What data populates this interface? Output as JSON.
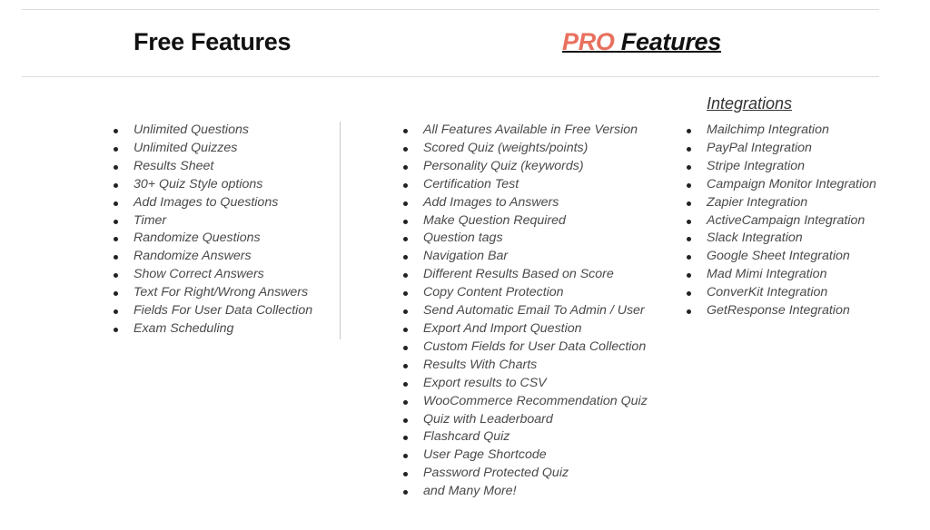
{
  "headings": {
    "free": "Free Features",
    "pro_accent": "PRO",
    "pro_rest": " Features",
    "integrations": "Integrations"
  },
  "colors": {
    "accent": "#e8705e",
    "heading": "#111111",
    "text": "#4a4a4a"
  },
  "free_features": [
    "Unlimited Questions",
    "Unlimited Quizzes",
    "Results Sheet",
    "30+ Quiz Style options",
    "Add Images to Questions",
    "Timer",
    "Randomize Questions",
    "Randomize Answers",
    "Show Correct Answers",
    "Text For Right/Wrong Answers",
    "Fields For User Data Collection",
    "Exam Scheduling"
  ],
  "pro_features": [
    "All Features Available in Free Version",
    "Scored Quiz (weights/points)",
    "Personality Quiz (keywords)",
    "Certification Test",
    "Add Images to Answers",
    "Make Question Required",
    "Question tags",
    "Navigation Bar",
    "Different Results Based on Score",
    "Copy Content Protection",
    "Send Automatic Email To Admin / User",
    "Export And Import Question",
    "Custom Fields for User Data Collection",
    "Results With Charts",
    "Export results to CSV",
    "WooCommerce Recommendation Quiz",
    "Quiz with Leaderboard",
    "Flashcard Quiz",
    "User Page Shortcode",
    "Password Protected Quiz",
    "and Many More!"
  ],
  "integrations": [
    "Mailchimp Integration",
    "PayPal Integration",
    "Stripe Integration",
    "Campaign Monitor Integration",
    "Zapier Integration",
    "ActiveCampaign Integration",
    "Slack Integration",
    "Google Sheet Integration",
    "Mad Mimi Integration",
    "ConverKit Integration",
    "GetResponse Integration"
  ]
}
